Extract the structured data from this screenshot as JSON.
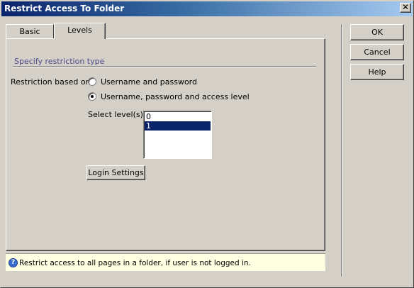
{
  "window": {
    "title": "Restrict Access To Folder",
    "close_glyph": "✕"
  },
  "tabs": [
    {
      "label": "Basic",
      "active": false
    },
    {
      "label": "Levels",
      "active": true
    }
  ],
  "levels": {
    "section_heading": "Specify restriction type",
    "restriction_label": "Restriction based on:",
    "options": [
      {
        "label": "Username and password",
        "checked": false
      },
      {
        "label": "Username, password and access level",
        "checked": true
      }
    ],
    "select_levels_label": "Select level(s):",
    "level_items": [
      {
        "label": "0",
        "selected": false
      },
      {
        "label": "1",
        "selected": true
      }
    ],
    "login_settings_label": "Login Settings"
  },
  "buttons": {
    "ok": "OK",
    "cancel": "Cancel",
    "help": "Help"
  },
  "status": {
    "icon": "question-icon",
    "icon_glyph": "?",
    "text": "Restrict access to all pages in a folder, if user is not logged in."
  },
  "colors": {
    "dialog_bg": "#d4d0c8",
    "title_bar": "#0a246a",
    "selection": "#0a246a",
    "status_bg": "#ffffe1"
  }
}
